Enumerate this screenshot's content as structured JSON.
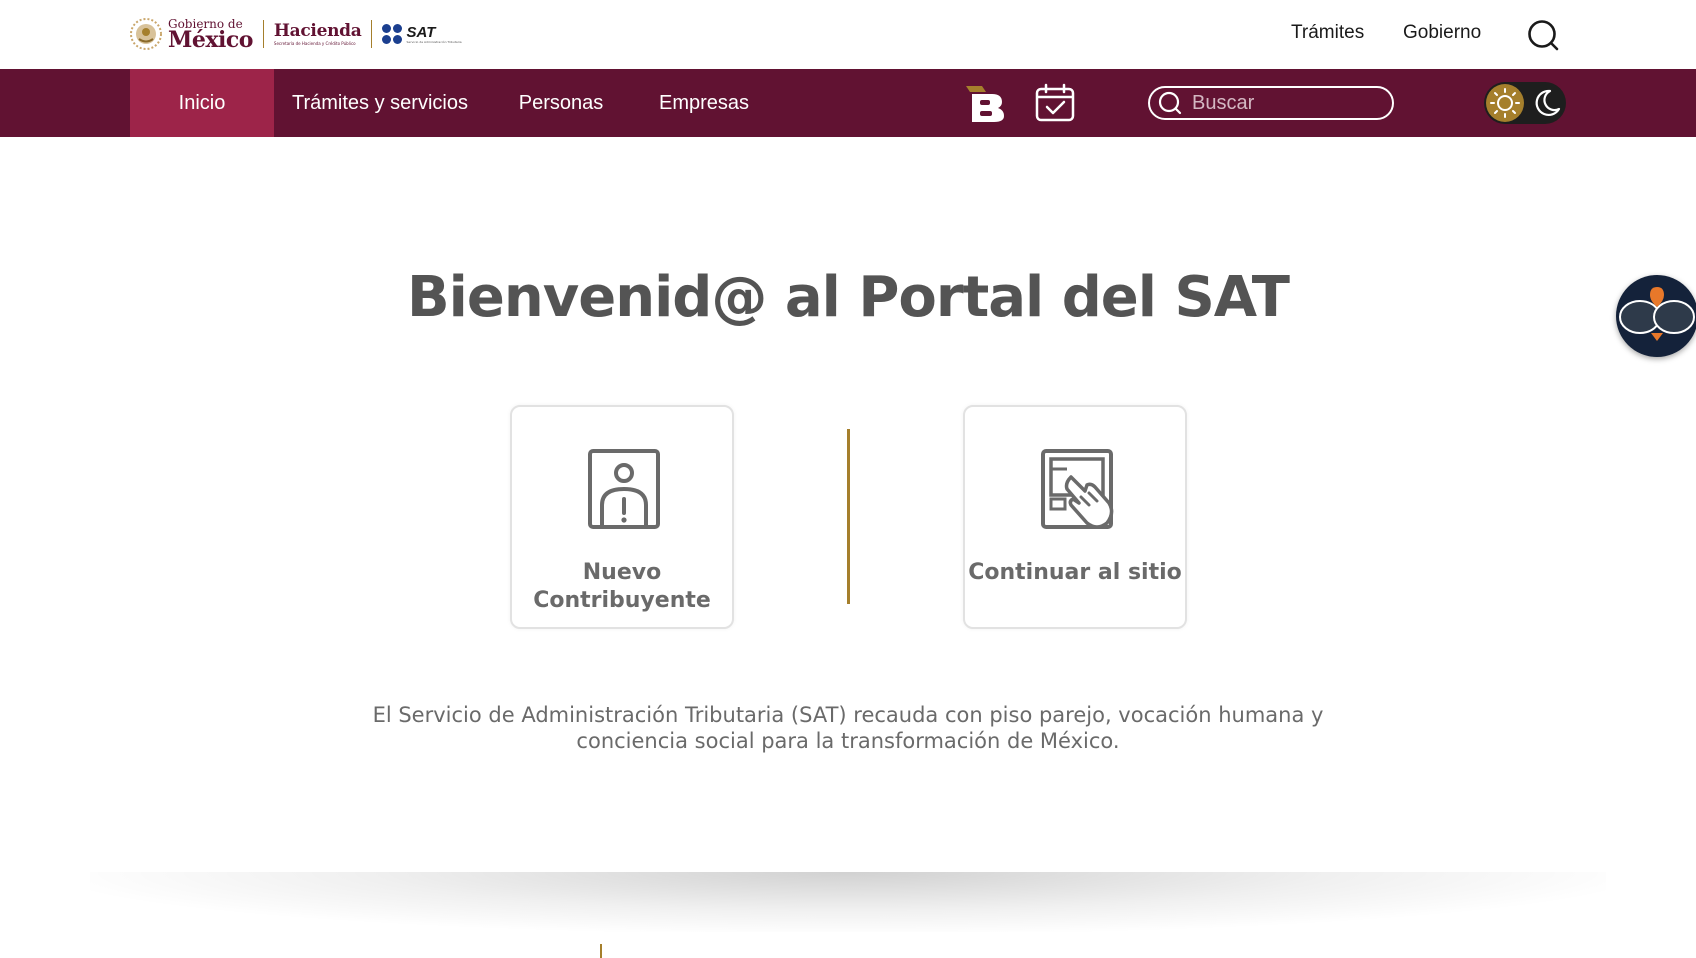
{
  "header": {
    "logo_gobierno_small": "Gobierno de",
    "logo_gobierno_big": "México",
    "logo_hacienda": "Hacienda",
    "logo_hacienda_sub": "Secretaría de Hacienda y Crédito Público",
    "logo_sat": "SAT",
    "logo_sat_sub": "Servicio de Administración Tributaria",
    "links": [
      "Trámites",
      "Gobierno"
    ],
    "search_icon": "search-icon"
  },
  "nav": {
    "items": [
      "Inicio",
      "Trámites y servicios",
      "Personas",
      "Empresas"
    ],
    "active": "Inicio",
    "icons": [
      "b-logo-icon",
      "calendar-check-icon"
    ],
    "search_placeholder": "Buscar",
    "theme_icons": [
      "sun-icon",
      "moon-icon"
    ]
  },
  "main": {
    "title": "Bienvenid@ al Portal del SAT",
    "cards": [
      {
        "label": "Nuevo Contribuyente",
        "icon": "person-alert-icon"
      },
      {
        "label": "Continuar al sitio",
        "icon": "hand-touch-screen-icon"
      }
    ],
    "description": "El Servicio de Administración Tributaria (SAT) recauda con piso parejo, vocación humana y conciencia social para la transformación de México."
  },
  "assistant": {
    "icon": "owl-assistant-icon"
  },
  "colors": {
    "guinda": "#611232",
    "guinda_active": "#9d2449",
    "gold": "#a57f2c",
    "text_gray": "#6a6a6a",
    "title_gray": "#545454"
  }
}
